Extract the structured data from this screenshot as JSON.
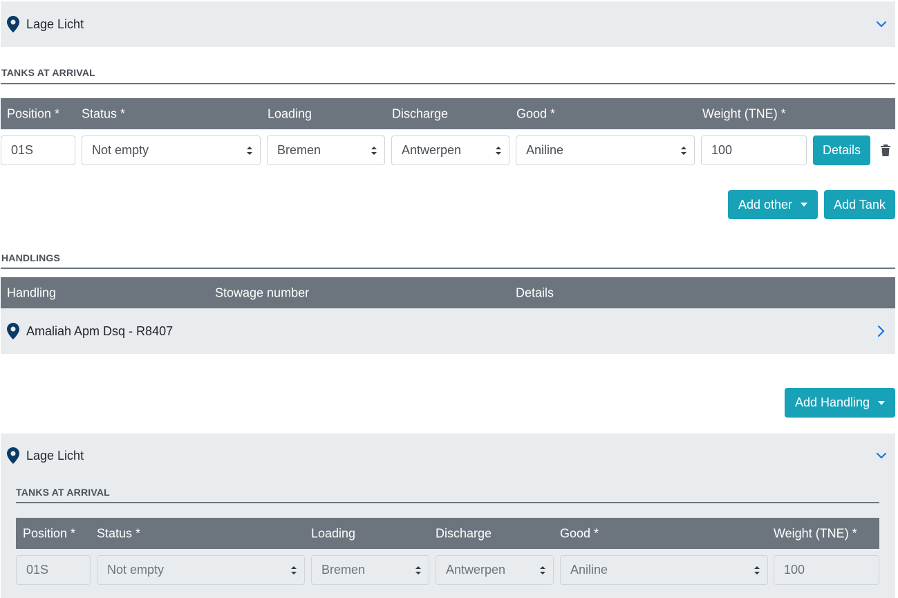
{
  "accordion1": {
    "title": "Lage Licht"
  },
  "tanks1": {
    "section_title": "TANKS AT ARRIVAL",
    "headers": {
      "position": "Position *",
      "status": "Status *",
      "loading": "Loading",
      "discharge": "Discharge",
      "good": "Good *",
      "weight": "Weight (TNE) *"
    },
    "row": {
      "position": "01S",
      "status": "Not empty",
      "loading": "Bremen",
      "discharge": "Antwerpen",
      "good": "Aniline",
      "weight": "100"
    },
    "details_label": "Details",
    "add_other_label": "Add other",
    "add_tank_label": "Add Tank"
  },
  "handlings": {
    "section_title": "HANDLINGS",
    "headers": {
      "handling": "Handling",
      "stowage": "Stowage number",
      "details": "Details"
    },
    "row_title": "Amaliah Apm Dsq - R8407",
    "add_handling_label": "Add Handling"
  },
  "accordion2": {
    "title": "Lage Licht"
  },
  "tanks2": {
    "section_title": "TANKS AT ARRIVAL",
    "headers": {
      "position": "Position *",
      "status": "Status *",
      "loading": "Loading",
      "discharge": "Discharge",
      "good": "Good *",
      "weight": "Weight (TNE) *"
    },
    "row": {
      "position": "01S",
      "status": "Not empty",
      "loading": "Bremen",
      "discharge": "Antwerpen",
      "good": "Aniline",
      "weight": "100"
    }
  },
  "colors": {
    "accent": "#17a2b8",
    "header_bg": "#6c757d",
    "panel_bg": "#e9ecef",
    "pin": "#0b3a66",
    "link": "#1a73e8"
  }
}
